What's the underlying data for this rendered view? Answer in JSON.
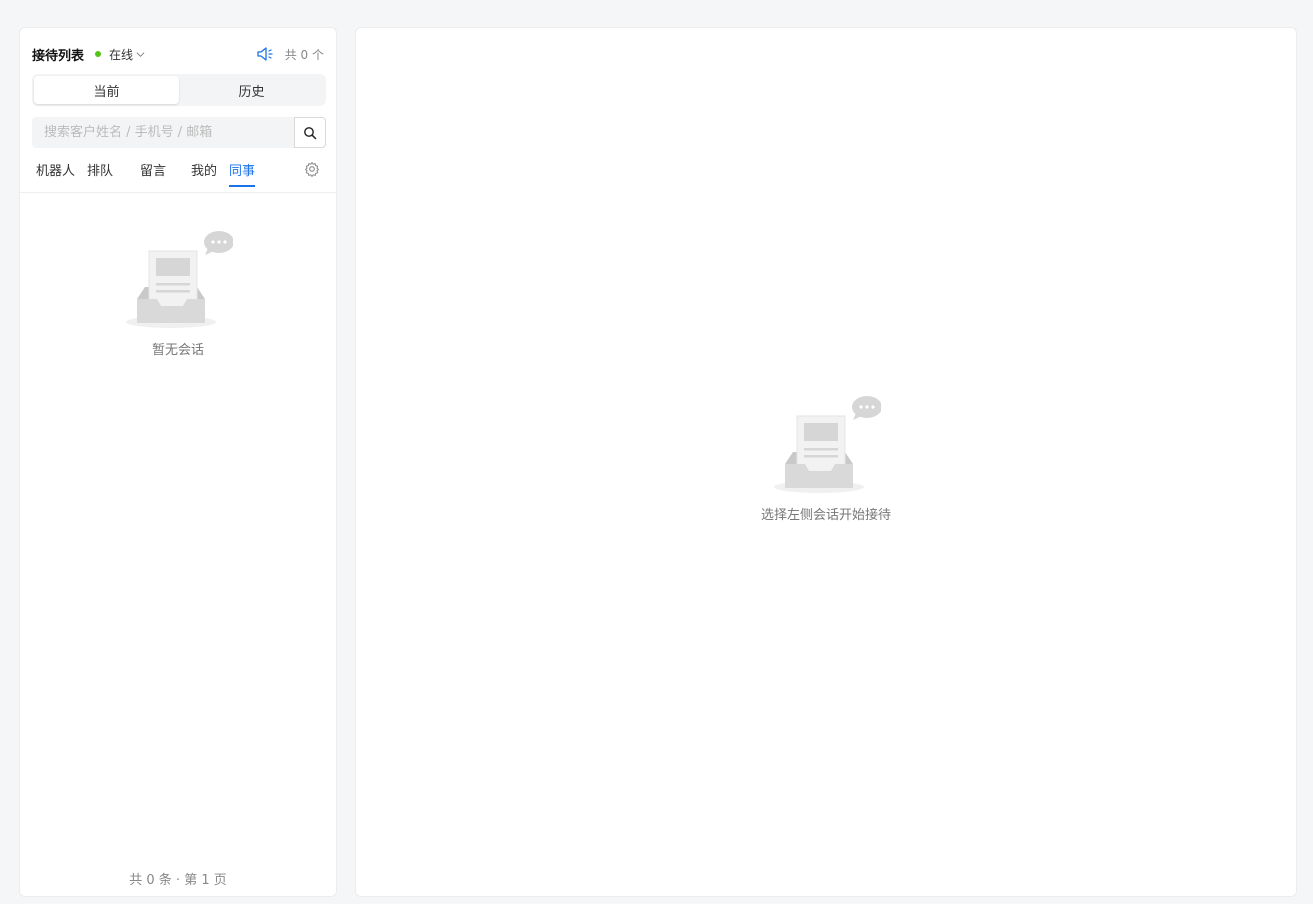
{
  "colors": {
    "accent": "#1a73e8",
    "online": "#52c41a"
  },
  "left_panel": {
    "title": "接待列表",
    "status": "在线",
    "count": "共 0 个",
    "segments": [
      {
        "label": "当前",
        "active": true
      },
      {
        "label": "历史",
        "active": false
      }
    ],
    "search": {
      "placeholder": "搜索客户姓名 / 手机号 / 邮箱",
      "value": ""
    },
    "tabs": [
      {
        "label": "机器人",
        "active": false
      },
      {
        "label": "排队",
        "active": false
      },
      {
        "label": "留言",
        "active": false
      },
      {
        "label": "我的",
        "active": false
      },
      {
        "label": "同事",
        "active": true
      }
    ],
    "empty_text": "暂无会话",
    "footer": "共 0 条 · 第 1 页"
  },
  "right_panel": {
    "empty_text": "选择左侧会话开始接待"
  },
  "icons": {
    "speaker": "speaker-icon",
    "search": "search-icon",
    "settings": "gear-icon",
    "dropdown": "chevron-down-icon",
    "empty": "empty-inbox-icon"
  }
}
